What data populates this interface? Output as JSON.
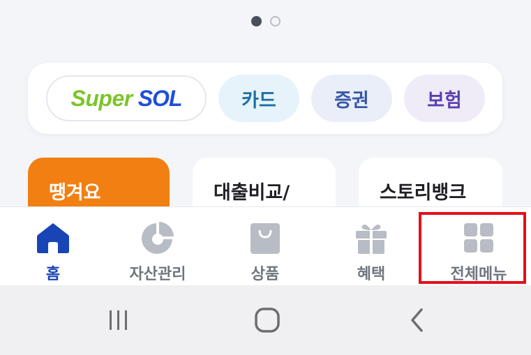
{
  "carousel": {
    "active_index": 1,
    "count": 2
  },
  "quick_links": {
    "supersol": {
      "part1": "Super",
      "part2": "SOL"
    },
    "card": "카드",
    "stock": "증권",
    "insurance": "보험"
  },
  "promo_cards": [
    "땡겨요",
    "대출비교/",
    "스토리뱅크"
  ],
  "tabbar": {
    "tabs": [
      {
        "label": "홈",
        "icon": "home-icon",
        "active": true
      },
      {
        "label": "자산관리",
        "icon": "pie-chart-icon",
        "active": false
      },
      {
        "label": "상품",
        "icon": "shopping-bag-icon",
        "active": false
      },
      {
        "label": "혜택",
        "icon": "gift-icon",
        "active": false
      },
      {
        "label": "전체메뉴",
        "icon": "grid-menu-icon",
        "active": false
      }
    ]
  },
  "colors": {
    "active_tab": "#1745b5",
    "inactive_tab": "#70757e",
    "highlight": "#e3101a",
    "promo_orange": "#f27f12"
  },
  "system_nav": {
    "buttons": [
      "recent-apps-icon",
      "home-button-icon",
      "back-icon"
    ]
  }
}
